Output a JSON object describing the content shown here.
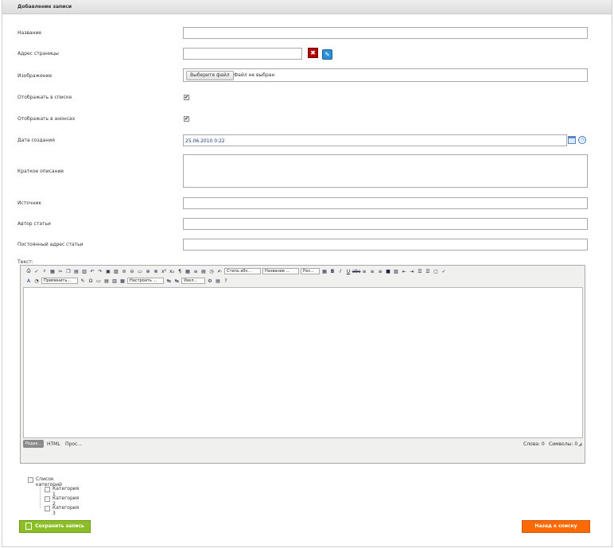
{
  "header": {
    "title": "Добавление записи"
  },
  "form": {
    "name_label": "Название",
    "name_value": "",
    "page_address_label": "Адрес страницы",
    "page_address_value": "",
    "image_label": "Изображение",
    "file_button": "Выберите файл",
    "file_status": "Файл не выбран",
    "show_in_list_label": "Отображать в списке",
    "show_in_list_checked": true,
    "show_in_announces_label": "Отображать в анонсах",
    "show_in_announces_checked": true,
    "created_date_label": "Дата создания",
    "created_date_value": "25.06.2010 0:22",
    "short_description_label": "Краткое описание",
    "source_label": "Источник",
    "author_label": "Автор статьи",
    "permalink_label": "Постоянный адрес статьи",
    "text_label": "Текст:"
  },
  "editor": {
    "style_select": "Стиль абз...",
    "name_select": "Название ...",
    "size_select": "Раз...",
    "apply_select": "Применить...",
    "configure_select": "Настроить ...",
    "zoom_select": "Увел...",
    "tabs": [
      "Редак...",
      "HTML",
      "Прос..."
    ],
    "words_label": "Слова: 0",
    "chars_label": "Символы: 0"
  },
  "categories": {
    "root": "Список категорий",
    "items": [
      "Категория 1",
      "Категория 2",
      "Категория 3"
    ]
  },
  "buttons": {
    "save": "Сохранить запись",
    "back": "Назад к списку"
  },
  "colors": {
    "save_button": "#8cbf26",
    "back_button": "#ff6a00",
    "remove_icon": "#b30000",
    "edit_icon": "#2a8fd6"
  }
}
